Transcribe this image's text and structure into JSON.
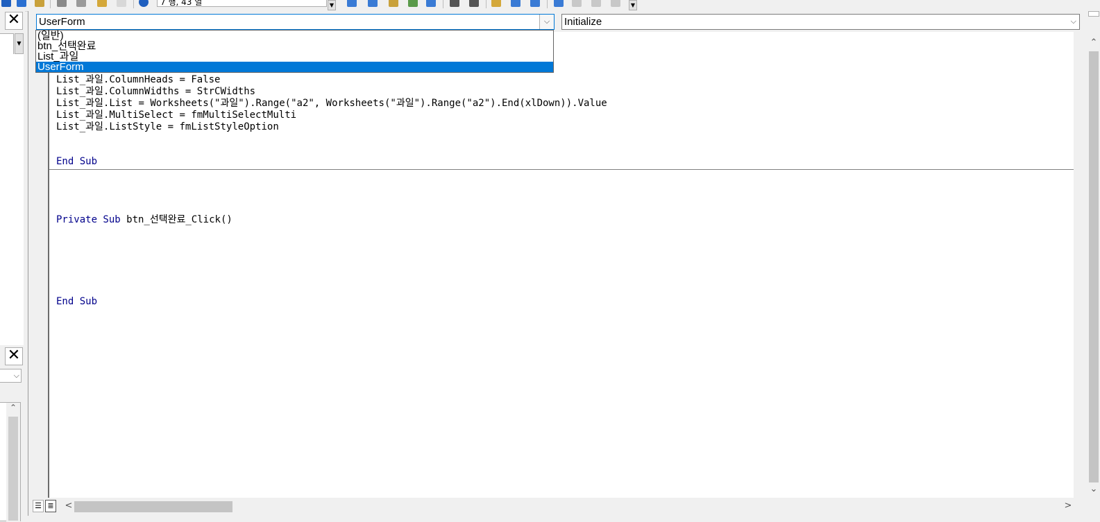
{
  "toolbar": {
    "position_text": "7 행, 43 열",
    "icons": [
      "save-icon",
      "cut-icon",
      "copy-icon",
      "paste-icon",
      "find-icon",
      "undo-icon",
      "help-icon",
      "list-members-icon",
      "list-constants-icon",
      "quick-info-icon",
      "parameter-info-icon",
      "complete-word-icon",
      "indent-icon",
      "outdent-icon",
      "breakpoint-icon",
      "comment-block-icon",
      "uncomment-block-icon",
      "bookmark-icon",
      "next-bookmark-icon",
      "prev-bookmark-icon",
      "clear-bookmarks-icon"
    ]
  },
  "left_panes": {
    "close_symbol": "✕"
  },
  "code_window": {
    "object_combo": {
      "value": "UserForm",
      "options": [
        "(일반)",
        "btn_선택완료",
        "List_과일",
        "UserForm"
      ],
      "selected_index": 3
    },
    "procedure_combo": {
      "value": "Initialize"
    },
    "code_lines": [
      {
        "segments": [
          {
            "text": "List_과일.ColumnHeads = False",
            "kw": false
          }
        ]
      },
      {
        "segments": [
          {
            "text": "List_과일.ColumnWidths = StrCWidths",
            "kw": false
          }
        ]
      },
      {
        "segments": [
          {
            "text": "List_과일.List = Worksheets(\"과일\").Range(\"a2\", Worksheets(\"과일\").Range(\"a2\").End(xlDown)).Value",
            "kw": false
          }
        ]
      },
      {
        "segments": [
          {
            "text": "List_과일.MultiSelect = fmMultiSelectMulti",
            "kw": false
          }
        ]
      },
      {
        "segments": [
          {
            "text": "List_과일.ListStyle = fmListStyleOption",
            "kw": false
          }
        ]
      },
      {
        "segments": [
          {
            "text": "End Sub",
            "kw": true
          }
        ]
      },
      {
        "segments": [
          {
            "text": "Private Sub",
            "kw": true
          },
          {
            "text": " btn_선택완료_Click()",
            "kw": false
          }
        ]
      },
      {
        "segments": [
          {
            "text": "End Sub",
            "kw": true
          }
        ]
      }
    ]
  },
  "colors": {
    "keyword": "#00008b",
    "selection": "#0078d7"
  }
}
